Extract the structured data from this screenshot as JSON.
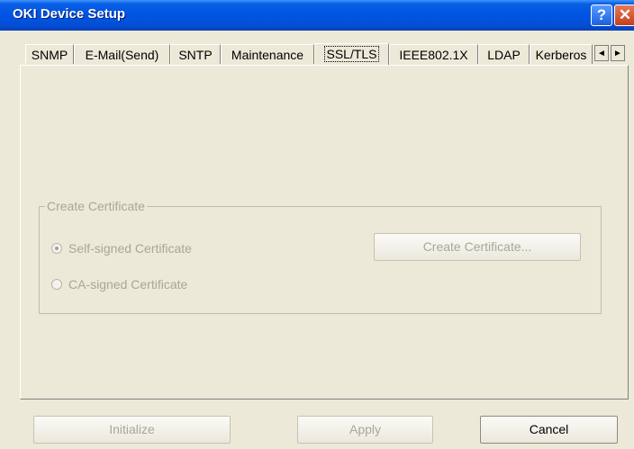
{
  "window": {
    "title": "OKI Device Setup",
    "help_glyph": "?",
    "close_glyph": "✕"
  },
  "tabs": [
    {
      "label": "SNMP"
    },
    {
      "label": "E-Mail(Send)"
    },
    {
      "label": "SNTP"
    },
    {
      "label": "Maintenance"
    },
    {
      "label": "SSL/TLS",
      "active": true
    },
    {
      "label": "IEEE802.1X"
    },
    {
      "label": "LDAP"
    },
    {
      "label": "Kerberos"
    }
  ],
  "tab_scroll": {
    "left_glyph": "◄",
    "right_glyph": "►"
  },
  "create_certificate": {
    "group_title": "Create Certificate",
    "self_signed_label": "Self-signed Certificate",
    "ca_signed_label": "CA-signed Certificate",
    "create_button": "Create Certificate...",
    "selected": "Self-signed Certificate"
  },
  "footer": {
    "initialize": "Initialize",
    "apply": "Apply",
    "cancel": "Cancel"
  },
  "colors": {
    "titlebar": "#0054e3",
    "dialog_bg": "#ece9d8",
    "disabled_text": "#a9a69a"
  }
}
